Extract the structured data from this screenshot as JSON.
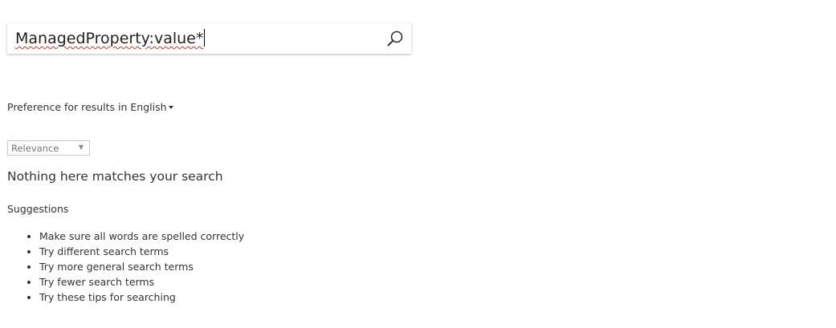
{
  "search": {
    "value": "ManagedProperty:value*",
    "icon": "search-icon"
  },
  "language_pref": {
    "prefix": "Preference for results in",
    "language": "English"
  },
  "sort": {
    "selected": "Relevance"
  },
  "results": {
    "message": "Nothing here matches your search"
  },
  "suggestions": {
    "title": "Suggestions",
    "items": [
      "Make sure all words are spelled correctly",
      "Try different search terms",
      "Try more general search terms",
      "Try fewer search terms",
      "Try these tips for searching"
    ]
  },
  "colors": {
    "spellcheck_underline": "#e0311c",
    "text": "#333333"
  }
}
